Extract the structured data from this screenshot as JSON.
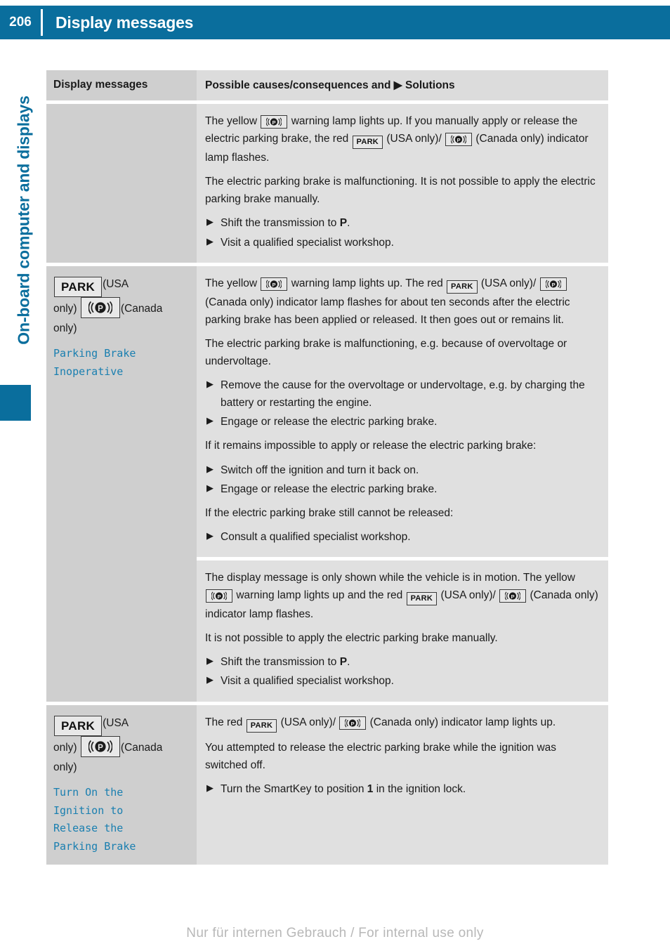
{
  "header": {
    "page_number": "206",
    "title": "Display messages"
  },
  "side": {
    "chapter_label": "On-board computer and displays"
  },
  "table": {
    "headers": {
      "left": "Display messages",
      "right_pre": "Possible causes/consequences and",
      "right_post": "Solutions"
    },
    "rows": [
      {
        "left": {
          "icons": [],
          "message_lines": []
        },
        "right": {
          "p1_a": "The yellow",
          "p1_b": "warning lamp lights up. If you manually apply or release the electric parking brake, the red",
          "p1_c": "(USA only)/",
          "p1_d": "(Canada only) indicator lamp flashes.",
          "p2": "The electric parking brake is malfunctioning. It is not possible to apply the electric parking brake manually.",
          "steps": [
            {
              "pre": "Shift the transmission to ",
              "bold": "P",
              "post": "."
            },
            {
              "pre": "Visit a qualified specialist workshop.",
              "bold": "",
              "post": ""
            }
          ]
        }
      },
      {
        "left": {
          "usa_label": "(USA only)",
          "canada_label": "(Canada only)",
          "message_lines": [
            "Parking Brake",
            "Inoperative"
          ]
        },
        "right": {
          "p1_a": "The yellow",
          "p1_b": "warning lamp lights up. The red",
          "p1_c": "(USA only)/",
          "p1_d": "(Canada only) indicator lamp flashes for about ten seconds after the electric parking brake has been applied or released. It then goes out or remains lit.",
          "p2": "The electric parking brake is malfunctioning, e.g. because of overvoltage or undervoltage.",
          "steps_1": [
            "Remove the cause for the overvoltage or undervoltage, e.g. by charging the battery or restarting the engine.",
            "Engage or release the electric parking brake."
          ],
          "p3": "If it remains impossible to apply or release the electric parking brake:",
          "steps_2": [
            "Switch off the ignition and turn it back on.",
            "Engage or release the electric parking brake."
          ],
          "p4": "If the electric parking brake still cannot be released:",
          "steps_3": [
            "Consult a qualified specialist workshop."
          ]
        }
      },
      {
        "left": {
          "icons": [],
          "message_lines": []
        },
        "right": {
          "p1_a": "The display message is only shown while the vehicle is in motion. The yellow",
          "p1_b": "warning lamp lights up and the red",
          "p1_c": "(USA only)/",
          "p1_d": "(Canada only) indicator lamp flashes.",
          "p2": "It is not possible to apply the electric parking brake manually.",
          "steps": [
            {
              "pre": "Shift the transmission to ",
              "bold": "P",
              "post": "."
            },
            {
              "pre": "Visit a qualified specialist workshop.",
              "bold": "",
              "post": ""
            }
          ]
        }
      },
      {
        "left": {
          "usa_label": "(USA only)",
          "canada_label": "(Canada only)",
          "message_lines": [
            "Turn On the",
            "Ignition to",
            "Release the",
            "Parking Brake"
          ]
        },
        "right": {
          "p1_a": "The red",
          "p1_b": "(USA only)/",
          "p1_c": "(Canada only) indicator lamp lights up.",
          "p2": "You attempted to release the electric parking brake while the ignition was switched off.",
          "step_pre": "Turn the SmartKey to position ",
          "step_bold": "1",
          "step_post": " in the ignition lock."
        }
      }
    ]
  },
  "icons": {
    "park_label": "PARK",
    "brake_name": "parking-brake-indicator-icon",
    "triangle": "▶"
  },
  "footer": {
    "watermark": "Nur für internen Gebrauch / For internal use only"
  },
  "colors": {
    "brand_blue": "#0a6e9d",
    "message_blue": "#1a7fb0",
    "left_cell_bg": "#cfcfcf",
    "right_cell_bg": "#e0e0e0"
  }
}
